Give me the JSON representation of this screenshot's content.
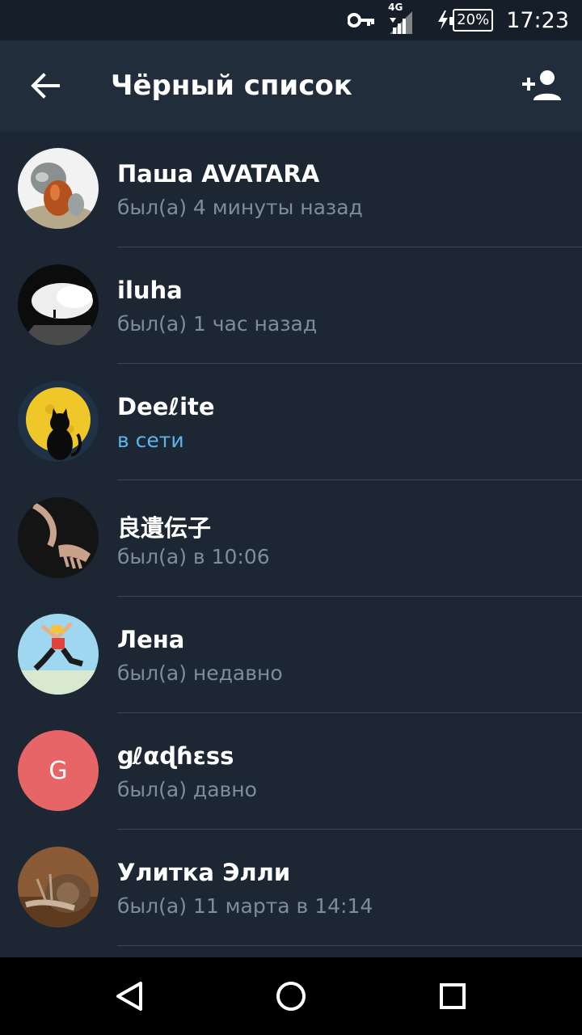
{
  "status_bar": {
    "network_type": "4G",
    "battery": "20%",
    "time": "17:23"
  },
  "app_bar": {
    "title": "Чёрный список"
  },
  "contacts": [
    {
      "name": "Паша AVATARA",
      "status": "был(а) 4 минуты назад",
      "avatar": "photo",
      "online": false
    },
    {
      "name": "iluha",
      "status": "был(а) 1 час назад",
      "avatar": "photo",
      "online": false
    },
    {
      "name": "Deeℓite",
      "status": "в сети",
      "avatar": "photo",
      "online": true
    },
    {
      "name": "良遺伝子",
      "status": "был(а) в 10:06",
      "avatar": "photo",
      "online": false
    },
    {
      "name": "Лена",
      "status": "был(а) недавно",
      "avatar": "photo",
      "online": false
    },
    {
      "name": "ցℓαɖɦɛss",
      "status": "был(а) давно",
      "avatar": "letter",
      "avatar_letter": "G",
      "avatar_color": "#e76567",
      "online": false
    },
    {
      "name": "Улитка Элли",
      "status": "был(а) 11 марта в 14:14",
      "avatar": "photo",
      "online": false
    }
  ],
  "colors": {
    "background": "#1d2733",
    "app_bar": "#212d3b",
    "online_status": "#5cb5ee",
    "offline_status": "#7f8d9b"
  },
  "icons": {
    "back": "arrow-left-icon",
    "add_user": "person-add-icon",
    "vpn_key": "key-icon",
    "signal": "signal-icon",
    "charging": "bolt-icon",
    "nav_back": "triangle-back-icon",
    "nav_home": "circle-home-icon",
    "nav_recents": "square-recents-icon"
  }
}
